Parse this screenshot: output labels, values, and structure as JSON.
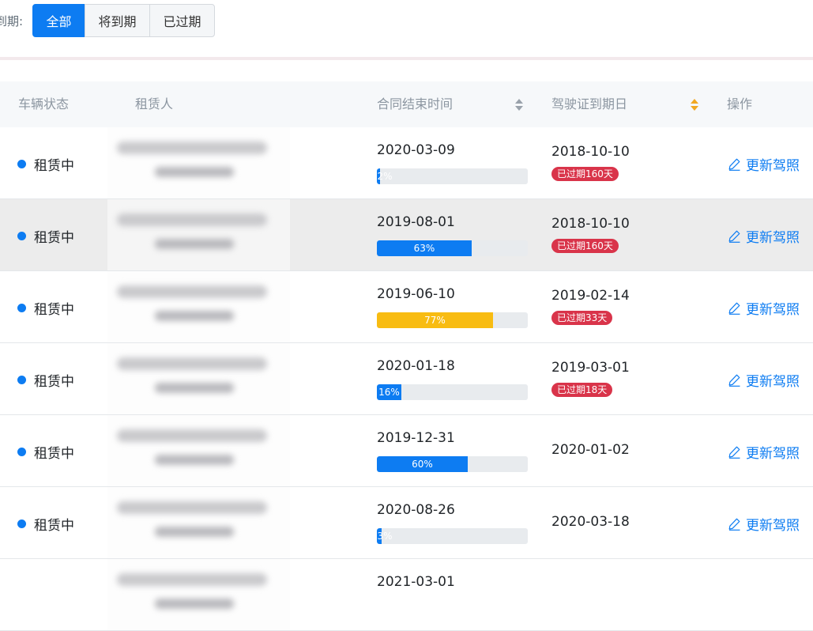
{
  "filter": {
    "label": "到期:",
    "options": [
      "全部",
      "将到期",
      "已过期"
    ],
    "selected": "全部"
  },
  "table": {
    "columns": {
      "status": "车辆状态",
      "tenant": "租赁人",
      "contract_end": "合同结束时间",
      "license_expiry": "驾驶证到期日",
      "actions": "操作"
    },
    "rows": [
      {
        "status": "租赁中",
        "contract_end": "2020-03-09",
        "progress": 2,
        "progress_label": "2%",
        "progress_color": "#0d7cf2",
        "license_expiry": "2018-10-10",
        "badge": "已过期160天",
        "action": "更新驾照"
      },
      {
        "status": "租赁中",
        "contract_end": "2019-08-01",
        "progress": 63,
        "progress_label": "63%",
        "progress_color": "#0d7cf2",
        "license_expiry": "2018-10-10",
        "badge": "已过期160天",
        "action": "更新驾照"
      },
      {
        "status": "租赁中",
        "contract_end": "2019-06-10",
        "progress": 77,
        "progress_label": "77%",
        "progress_color": "#f8bc12",
        "license_expiry": "2019-02-14",
        "badge": "已过期33天",
        "action": "更新驾照"
      },
      {
        "status": "租赁中",
        "contract_end": "2020-01-18",
        "progress": 16,
        "progress_label": "16%",
        "progress_color": "#0d7cf2",
        "license_expiry": "2019-03-01",
        "badge": "已过期18天",
        "action": "更新驾照"
      },
      {
        "status": "租赁中",
        "contract_end": "2019-12-31",
        "progress": 60,
        "progress_label": "60%",
        "progress_color": "#0d7cf2",
        "license_expiry": "2020-01-02",
        "badge": "",
        "action": "更新驾照"
      },
      {
        "status": "租赁中",
        "contract_end": "2020-08-26",
        "progress": 3,
        "progress_label": "3%",
        "progress_color": "#0d7cf2",
        "license_expiry": "2020-03-18",
        "badge": "",
        "action": "更新驾照"
      },
      {
        "status": "",
        "contract_end": "2021-03-01",
        "progress": 0,
        "progress_label": "",
        "progress_color": "#0d7cf2",
        "license_expiry": "",
        "badge": "",
        "action": ""
      }
    ]
  },
  "colors": {
    "accent": "#0d7cf2",
    "warning": "#f8bc12",
    "danger": "#d9344a",
    "sort_active": "#f1a821"
  },
  "icons": {
    "status": "status-dot",
    "sort": "sort-icon",
    "edit": "edit-icon"
  }
}
